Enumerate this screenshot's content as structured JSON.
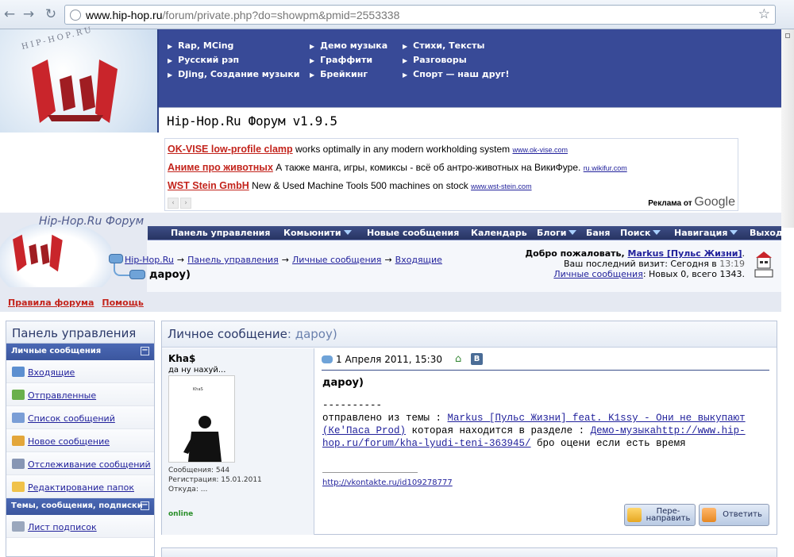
{
  "browser": {
    "url_host": "www.hip-hop.ru",
    "url_path": "/forum/private.php?do=showpm&pmid=2553338"
  },
  "site": {
    "logo_text": "HIP-HOP.RU",
    "title": "Hip-Hop.Ru Форум v1.9.5",
    "forum_name": "Hip-Hop.Ru Форум"
  },
  "topnav": {
    "col1": [
      "Rap, MCing",
      "Русский рэп",
      "DJing, Создание музыки"
    ],
    "col2": [
      "Демо музыка",
      "Граффити",
      "Брейкинг"
    ],
    "col3": [
      "Стихи, Тексты",
      "Разговоры",
      "Спорт — наш друг!"
    ]
  },
  "ads": [
    {
      "title": "OK-VISE low-profile clamp",
      "text": " works optimally in any modern workholding system ",
      "url": "www.ok-vise.com"
    },
    {
      "title": "Аниме про животных",
      "text": " А также манга, игры, комиксы - всё об антро-животных на ВикиФуре. ",
      "url": "ru.wikifur.com"
    },
    {
      "title": "WST Stein GmbH",
      "text": " New & Used Machine Tools 500 machines on stock ",
      "url": "www.wst-stein.com"
    }
  ],
  "ads_by": "Реклама от",
  "ads_by_brand": "Google",
  "navbar": {
    "items": [
      "Панель управления",
      "Комьюнити",
      "Новые сообщения",
      "Календарь",
      "Блоги",
      "Баня",
      "Поиск",
      "Навигация",
      "Выход"
    ]
  },
  "breadcrumb": {
    "items": [
      "Hip-Hop.Ru",
      "Панель управления",
      "Личные сообщения",
      "Входящие"
    ],
    "separator": "→",
    "current": "дароу)"
  },
  "welcome": {
    "greeting": "Добро пожаловать, ",
    "user": "Markus [Пульс Жизни]",
    "end": ".",
    "last_visit_label": "Ваш последний визит: Сегодня в ",
    "last_visit_time": "13:19",
    "pm_link": "Личные сообщения",
    "pm_counts": ": Новых 0, всего 1343."
  },
  "links": {
    "rules": "Правила форума",
    "help": "Помощь"
  },
  "sidebar": {
    "title": "Панель управления",
    "sections": [
      {
        "title": "Личные сообщения",
        "items": [
          "Входящие",
          "Отправленные",
          "Список сообщений",
          "Новое сообщение",
          "Отслеживание сообщений",
          "Редактирование папок"
        ]
      },
      {
        "title": "Темы, сообщения, подписки",
        "items": [
          "Лист подписок"
        ]
      }
    ],
    "minus": "−"
  },
  "message": {
    "panel_title": "Личное сообщение",
    "panel_subject": ": дароу)",
    "date": "1 Апреля 2011, 15:30",
    "subject": "дароу)",
    "body_rule": "----------",
    "body_prefix": "отправлено из темы : ",
    "topic_link": "Markus [Пульс Жизни] feat. K1ssy - Они не выкупают (Ке'Паса Prod)",
    "body_mid": " которая находится в разделе : ",
    "section_link": "Демо-музыкаhttp://www.hip-hop.ru/forum/kha-lyudi-teni-363945/",
    "body_end": " бро оцени если есть время",
    "signature": "http://vkontakte.ru/id109278777",
    "vk_label": "B",
    "forward_label": "Пере-\nнаправить",
    "reply_label": "Ответить"
  },
  "author": {
    "name": "Kha$",
    "title": "да ну нахуй...",
    "avatar_label": "KhaS",
    "posts": "Сообщения: 544",
    "registered": "Регистрация: 15.01.2011",
    "from": "Откуда: ...",
    "status": "online"
  }
}
